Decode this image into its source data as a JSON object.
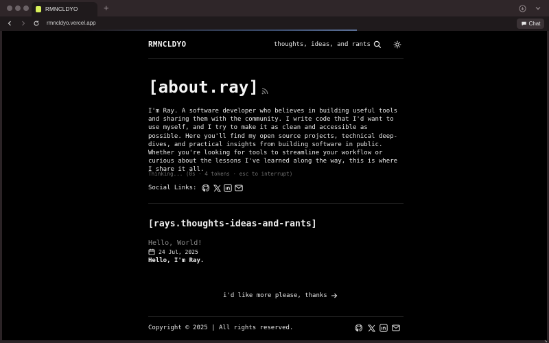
{
  "browser": {
    "tab_title": "RMNCLDYO",
    "new_tab_symbol": "+",
    "url": "rmncldyo.vercel.app",
    "chat_label": "Chat"
  },
  "header": {
    "brand": "RMNCLDYO",
    "nav_link": "thoughts, ideas, and rants"
  },
  "about": {
    "title": "[about.ray]",
    "body": "I'm Ray. A software developer who believes in building useful tools and sharing them with the community. I write code that I'd want to use myself, and I try to make it as clean and accessible as possible. Here you'll find my open source projects, technical deep-dives, and practical insights from building software in public. Whether you're looking for tools to streamline your workflow or curious about the lessons I've learned along the way, this is where I share it all.",
    "thinking": "Thinking... (0s · 4 tokens · esc to interrupt)",
    "social_label": "Social Links:"
  },
  "rants": {
    "title": "[rays.thoughts-ideas-and-rants]",
    "posts": [
      {
        "title": "Hello, World!",
        "date": "24 Jul, 2025",
        "excerpt": "Hello, I'm Ray."
      }
    ],
    "more_link": "i'd like more please, thanks"
  },
  "footer": {
    "copyright": "Copyright © 2025 | All rights reserved."
  },
  "icons": {
    "social": [
      "github-icon",
      "x-icon",
      "linkedin-icon",
      "mail-icon"
    ],
    "header": [
      "search-icon",
      "sun-icon"
    ]
  },
  "colors": {
    "page_background": "#000000",
    "text": "#e8e8e8",
    "muted": "#8a8a8a",
    "favicon": "#d8f05a"
  }
}
